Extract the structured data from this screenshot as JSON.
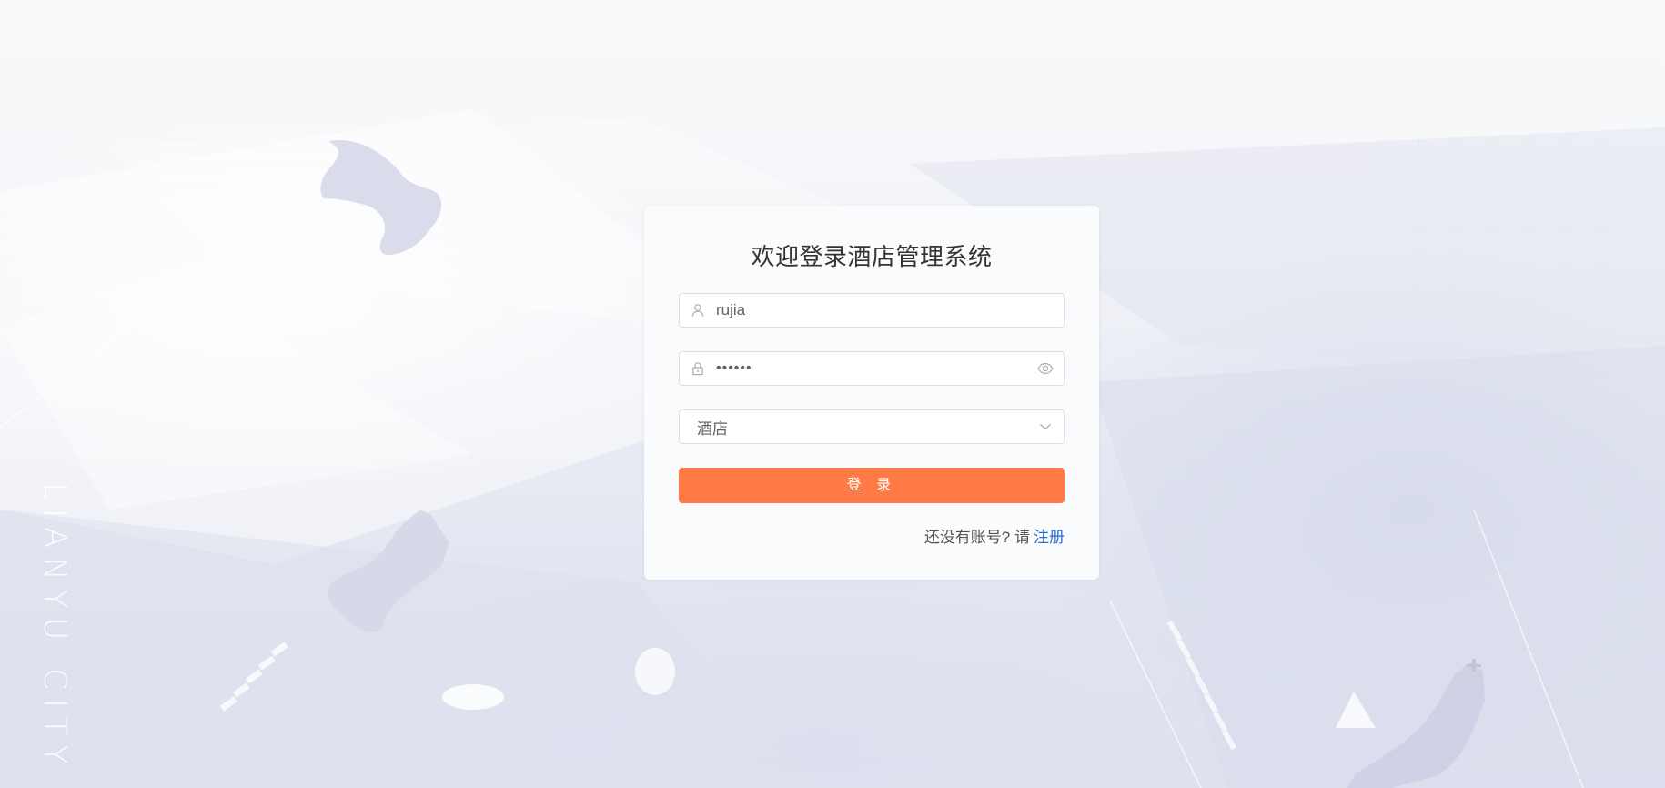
{
  "login": {
    "title": "欢迎登录酒店管理系统",
    "username_value": "rujia",
    "password_value": "••••••",
    "hotel_selected": "酒店",
    "submit_label": "登 录",
    "register_prompt": "还没有账号? 请",
    "register_link": "注册"
  },
  "background": {
    "vertical_text": "LIANYU CITY"
  },
  "icons": {
    "username": "user-icon",
    "password": "lock-icon",
    "password_toggle": "eye-icon",
    "hotel_select": "chevron-down-icon"
  },
  "colors": {
    "primary_button": "#ff7a45",
    "link": "#2b6cd4"
  }
}
